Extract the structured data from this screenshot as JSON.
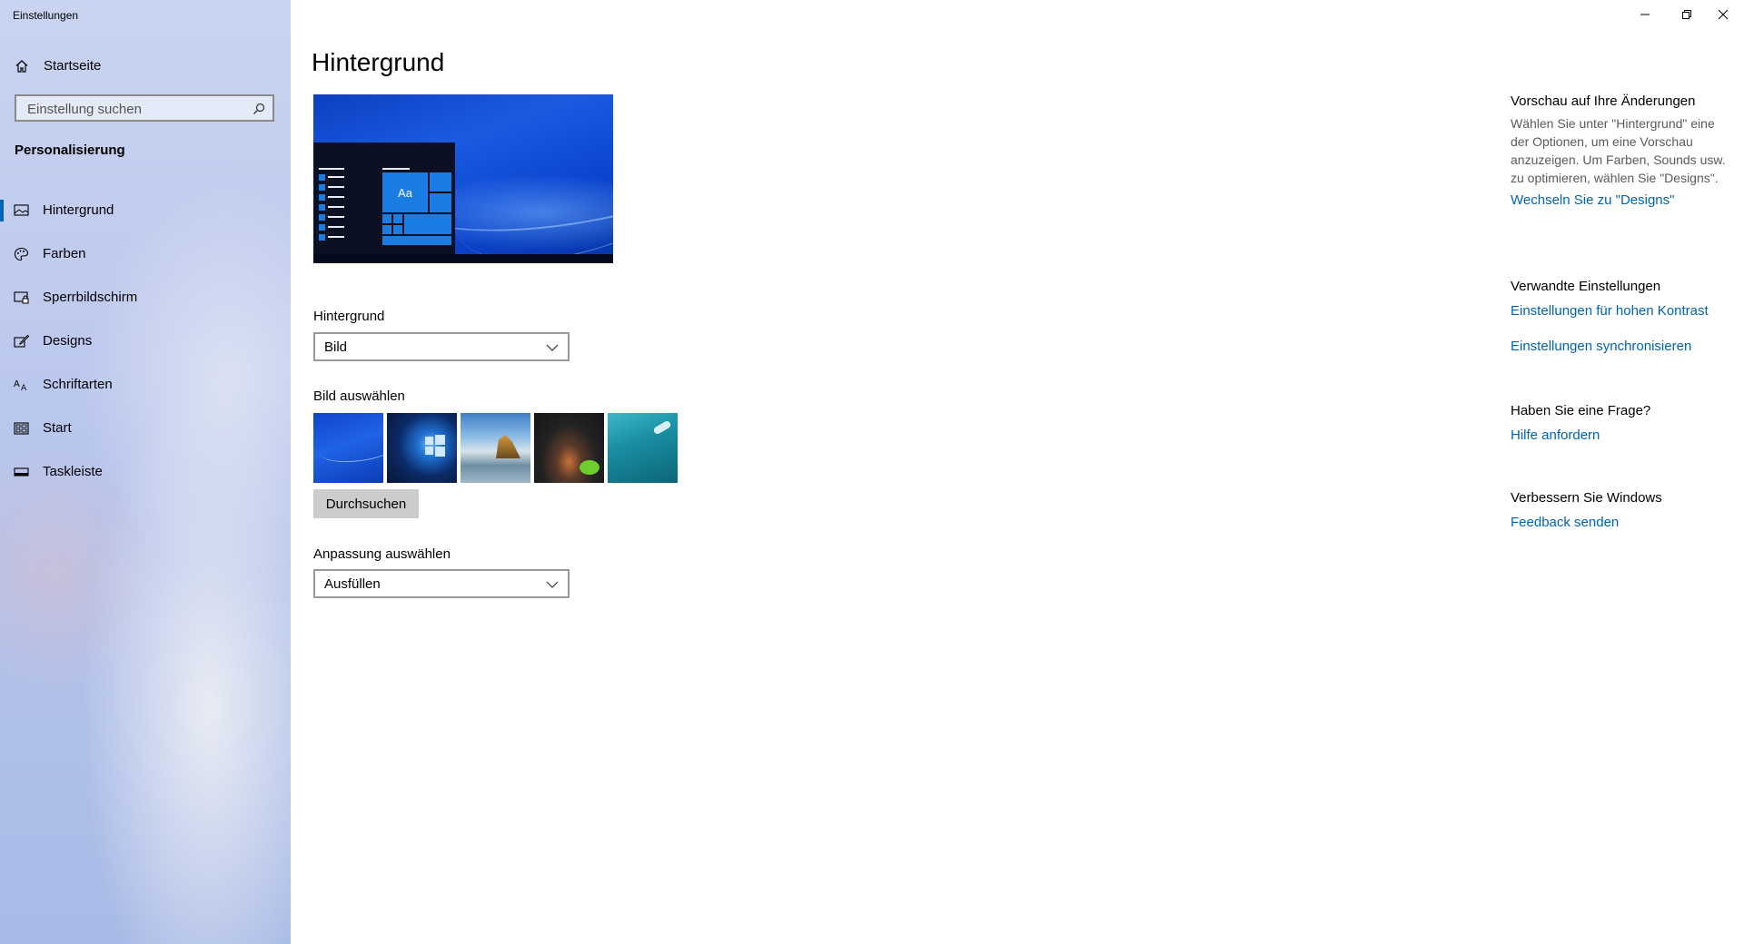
{
  "window": {
    "title": "Einstellungen",
    "controls": [
      "minimize-icon",
      "restore-icon",
      "close-icon"
    ]
  },
  "sidebar": {
    "home_label": "Startseite",
    "search_placeholder": "Einstellung suchen",
    "section_title": "Personalisierung",
    "items": [
      {
        "label": "Hintergrund",
        "icon": "picture-icon",
        "active": true
      },
      {
        "label": "Farben",
        "icon": "palette-icon",
        "active": false
      },
      {
        "label": "Sperrbildschirm",
        "icon": "lock-screen-icon",
        "active": false
      },
      {
        "label": "Designs",
        "icon": "brush-icon",
        "active": false
      },
      {
        "label": "Schriftarten",
        "icon": "font-icon",
        "active": false
      },
      {
        "label": "Start",
        "icon": "start-menu-icon",
        "active": false
      },
      {
        "label": "Taskleiste",
        "icon": "taskbar-icon",
        "active": false
      }
    ]
  },
  "main": {
    "title": "Hintergrund",
    "preview_tile_text": "Aa",
    "background_label": "Hintergrund",
    "background_value": "Bild",
    "choose_picture_label": "Bild auswählen",
    "browse_button": "Durchsuchen",
    "fit_label": "Anpassung auswählen",
    "fit_value": "Ausfüllen"
  },
  "right_pane": {
    "preview_heading": "Vorschau auf Ihre Änderungen",
    "preview_text": "Wählen Sie unter \"Hintergrund\" eine der Optionen, um eine Vorschau anzuzeigen. Um Farben, Sounds usw. zu optimieren, wählen Sie \"Designs\".",
    "preview_link": "Wechseln Sie zu \"Designs\"",
    "related_heading": "Verwandte Einstellungen",
    "related_link_1": "Einstellungen für hohen Kontrast",
    "related_link_2": "Einstellungen synchronisieren",
    "question_heading": "Haben Sie eine Frage?",
    "question_link": "Hilfe anfordern",
    "improve_heading": "Verbessern Sie Windows",
    "improve_link": "Feedback senden"
  },
  "colors": {
    "accent": "#0063b1",
    "link": "#0063b1",
    "sidebar_bg": "#bfcbee"
  }
}
